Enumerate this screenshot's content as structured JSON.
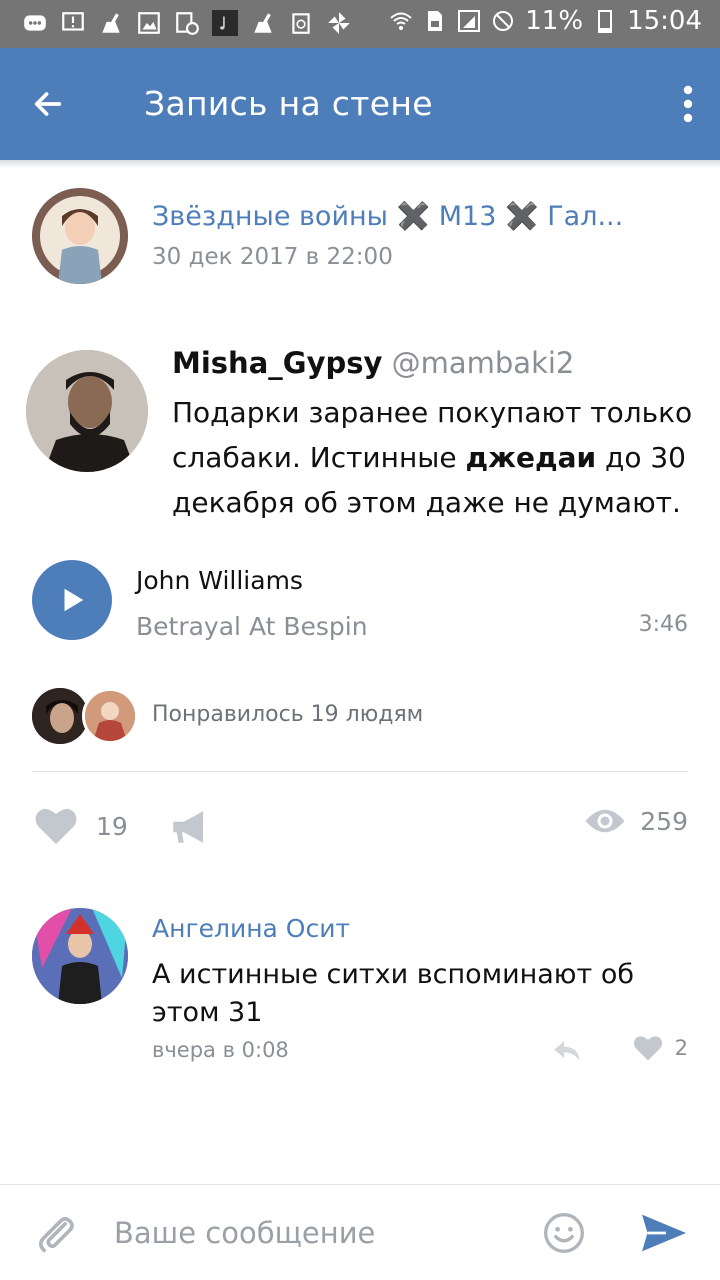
{
  "status_bar": {
    "battery": "11%",
    "time": "15:04"
  },
  "header": {
    "title": "Запись на стене"
  },
  "post": {
    "source": "Звёздные войны ✖️ M13 ✖️ Гал...",
    "date": "30 дек 2017 в 22:00",
    "tweet": {
      "username": "Misha_Gypsy",
      "handle": "@mambaki2",
      "text_before": "Подарки заранее покупают только слабаки. Истинные ",
      "text_bold": "джедаи",
      "text_after": " до 30 декабря об этом даже не думают."
    },
    "audio": {
      "artist": "John Williams",
      "title": "Betrayal At Bespin",
      "duration": "3:46"
    },
    "liked_by": "Понравилось 19 людям",
    "likes": "19",
    "views": "259"
  },
  "comment": {
    "author": "Ангелина Осит",
    "text": "А истинные ситхи вспоминают об этом 31",
    "time": "вчера в 0:08",
    "likes": "2"
  },
  "composer": {
    "placeholder": "Ваше сообщение"
  },
  "colors": {
    "accent": "#4e7eba",
    "status_bar": "#757575",
    "secondary_text": "#8a8f96"
  }
}
